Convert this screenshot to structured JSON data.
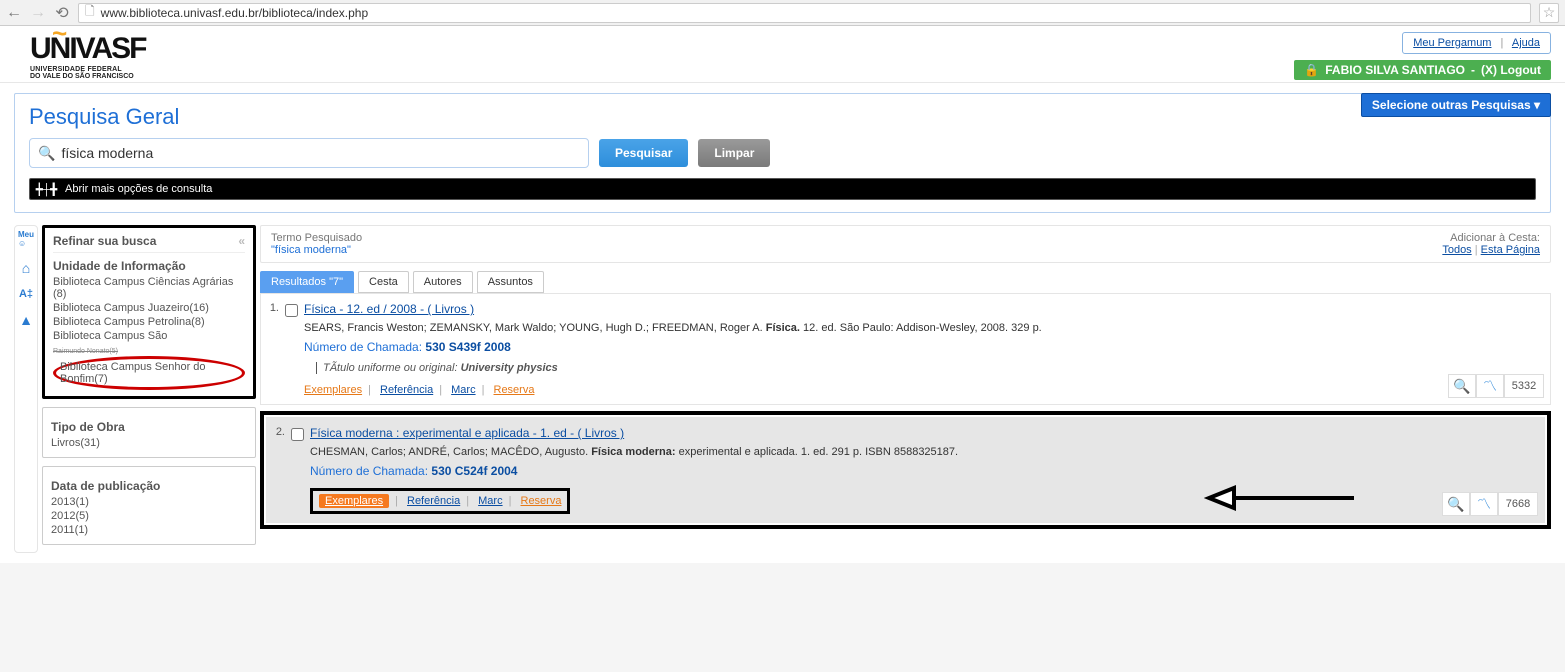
{
  "browser": {
    "url": "www.biblioteca.univasf.edu.br/biblioteca/index.php"
  },
  "logo": {
    "main": "UNIVASF",
    "sub1": "UNIVERSIDADE FEDERAL",
    "sub2": "DO VALE DO SÃO FRANCISCO"
  },
  "header": {
    "my_pergamum": "Meu Pergamum",
    "help": "Ajuda",
    "user": "FABIO SILVA SANTIAGO",
    "logout": "(X) Logout"
  },
  "search": {
    "title": "Pesquisa Geral",
    "other_btn": "Selecione outras Pesquisas",
    "placeholder": "",
    "value": "física moderna",
    "btn_search": "Pesquisar",
    "btn_clear": "Limpar",
    "more_options": "Abrir mais opções de consulta"
  },
  "term_row": {
    "label": "Termo Pesquisado",
    "value": "\"física moderna\"",
    "add_label": "Adicionar à Cesta:",
    "all": "Todos",
    "page": "Esta Página"
  },
  "sidebar": {
    "refine_title": "Refinar sua busca",
    "unit_title": "Unidade de Informação",
    "units": [
      "Biblioteca Campus Ciências Agrárias (8)",
      "Biblioteca Campus Juazeiro(16)",
      "Biblioteca Campus Petrolina(8)",
      "Biblioteca Campus São",
      "Biblioteca Campus Senhor do Bonfim(7)"
    ],
    "type_title": "Tipo de Obra",
    "types": [
      "Livros(31)"
    ],
    "date_title": "Data de publicação",
    "dates": [
      "2013(1)",
      "2012(5)",
      "2011(1)"
    ]
  },
  "tabs": {
    "results": "Resultados \"7\"",
    "basket": "Cesta",
    "authors": "Autores",
    "subjects": "Assuntos"
  },
  "results": [
    {
      "num": "1.",
      "title": "Física - 12. ed / 2008 -  ( Livros )",
      "meta_prefix": "SEARS, Francis Weston; ZEMANSKY, Mark Waldo; YOUNG, Hugh D.; FREEDMAN, Roger A. ",
      "meta_bold": "Física.",
      "meta_suffix": " 12. ed. São Paulo: Addison-Wesley, 2008. 329 p.",
      "call_label": "Número de Chamada: ",
      "call_value": "530 S439f 2008",
      "uniform_label": "TÃ­tulo uniforme ou original: ",
      "uniform_value": "University physics",
      "code": "5332"
    },
    {
      "num": "2.",
      "title": "Física moderna : experimental e aplicada - 1. ed -  ( Livros )",
      "meta_prefix": "CHESMAN, Carlos; ANDRÉ, Carlos; MACÊDO, Augusto. ",
      "meta_bold": "Física moderna:",
      "meta_suffix": " experimental e aplicada. 1. ed. 291 p. ISBN 8588325187.",
      "call_label": "Número de Chamada: ",
      "call_value": "530 C524f 2004",
      "code": "7668"
    }
  ],
  "actions": {
    "exemplares": "Exemplares",
    "referencia": "Referência",
    "marc": "Marc",
    "reserva": "Reserva"
  }
}
